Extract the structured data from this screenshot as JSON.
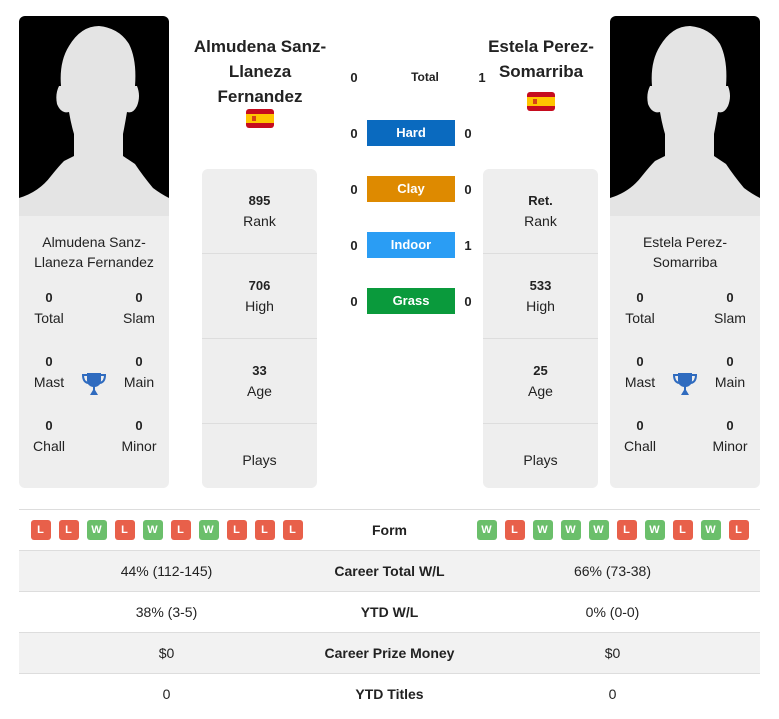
{
  "colors": {
    "win": "#6bbf6b",
    "loss": "#e8604a",
    "hard": "#0a6abf",
    "clay": "#de8a00",
    "indoor": "#2a9df4",
    "grass": "#0a9a3c",
    "trophy": "#2f6bbf"
  },
  "player1": {
    "name": "Almudena Sanz-Llaneza Fernandez",
    "name_lines": [
      "Almudena Sanz-",
      "Llaneza",
      "Fernandez"
    ],
    "card_name_lines": [
      "Almudena Sanz-",
      "Llaneza Fernandez"
    ],
    "flag": "spain-flag",
    "titles": {
      "total": "0",
      "slam": "0",
      "mast": "0",
      "main": "0",
      "chall": "0",
      "minor": "0"
    },
    "stats": {
      "rank": "895",
      "high": "706",
      "age": "33",
      "plays": ""
    },
    "form": [
      "L",
      "L",
      "W",
      "L",
      "W",
      "L",
      "W",
      "L",
      "L",
      "L"
    ]
  },
  "player2": {
    "name": "Estela Perez-Somarriba",
    "name_lines": [
      "Estela Perez-",
      "Somarriba"
    ],
    "card_name_lines": [
      "Estela Perez-",
      "Somarriba"
    ],
    "flag": "spain-flag",
    "titles": {
      "total": "0",
      "slam": "0",
      "mast": "0",
      "main": "0",
      "chall": "0",
      "minor": "0"
    },
    "stats": {
      "rank": "Ret.",
      "high": "533",
      "age": "25",
      "plays": ""
    },
    "form": [
      "W",
      "L",
      "W",
      "W",
      "W",
      "L",
      "W",
      "L",
      "W",
      "L"
    ]
  },
  "labels": {
    "total": "Total",
    "slam": "Slam",
    "mast": "Mast",
    "main": "Main",
    "chall": "Chall",
    "minor": "Minor",
    "rank": "Rank",
    "high": "High",
    "age": "Age",
    "plays": "Plays",
    "form": "Form"
  },
  "h2h": [
    {
      "label": "Total",
      "p1": "0",
      "p2": "1"
    },
    {
      "label": "Hard",
      "p1": "0",
      "p2": "0"
    },
    {
      "label": "Clay",
      "p1": "0",
      "p2": "0"
    },
    {
      "label": "Indoor",
      "p1": "0",
      "p2": "1"
    },
    {
      "label": "Grass",
      "p1": "0",
      "p2": "0"
    }
  ],
  "table": [
    {
      "label": "Career Total W/L",
      "p1": "44% (112-145)",
      "p2": "66% (73-38)"
    },
    {
      "label": "YTD W/L",
      "p1": "38% (3-5)",
      "p2": "0% (0-0)"
    },
    {
      "label": "Career Prize Money",
      "p1": "$0",
      "p2": "$0"
    },
    {
      "label": "YTD Titles",
      "p1": "0",
      "p2": "0"
    }
  ]
}
